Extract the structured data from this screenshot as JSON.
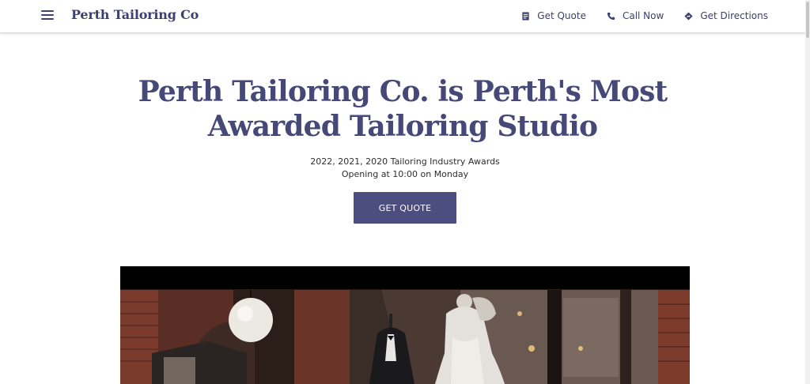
{
  "header": {
    "brand": "Perth Tailoring Co",
    "menu_icon": "hamburger-menu-icon",
    "nav": [
      {
        "label": "Get Quote",
        "icon": "quote-form-icon"
      },
      {
        "label": "Call Now",
        "icon": "phone-icon"
      },
      {
        "label": "Get Directions",
        "icon": "directions-icon"
      }
    ]
  },
  "hero": {
    "title_line1": "Perth Tailoring Co. is Perth's Most",
    "title_line2": "Awarded Tailoring Studio",
    "subtitle_line1": "2022, 2021, 2020 Tailoring Industry Awards",
    "subtitle_line2": "Opening at 10:00 on Monday",
    "cta_label": "GET QUOTE"
  },
  "colors": {
    "brand": "#3d3f6e",
    "title": "#464978",
    "button": "#4d4e80"
  }
}
